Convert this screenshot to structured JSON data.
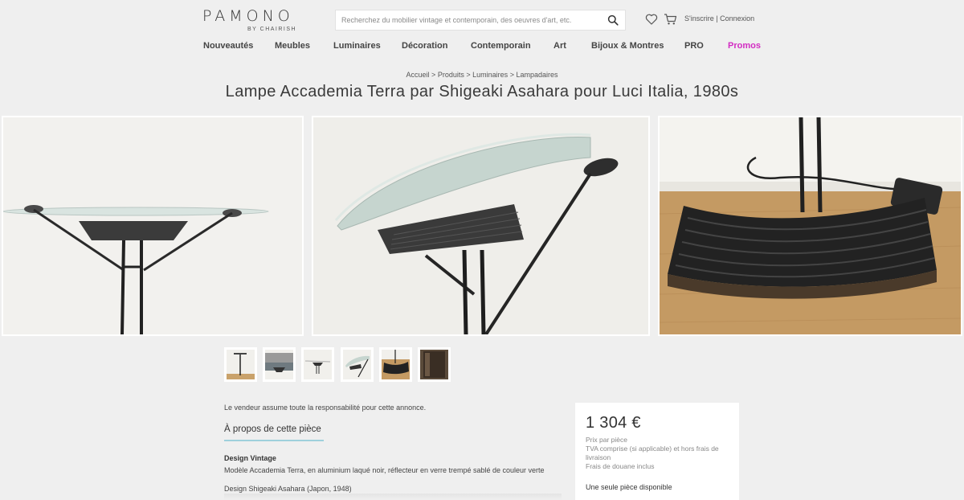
{
  "header": {
    "logo_text": "PAMONO",
    "logo_sub": "BY CHAIRISH",
    "search_placeholder": "Recherchez du mobilier vintage et contemporain, des oeuvres d'art, etc.",
    "signup_label": "S'inscrire",
    "separator": "|",
    "login_label": "Connexion"
  },
  "nav": {
    "items": [
      "Nouveautés",
      "Meubles",
      "Luminaires",
      "Décoration",
      "Contemporain",
      "Art",
      "Bijoux & Montres",
      "PRO",
      "Promos"
    ]
  },
  "breadcrumb": {
    "items": [
      "Accueil",
      "Produits",
      "Luminaires",
      "Lampadaires"
    ],
    "separator": ">"
  },
  "product": {
    "title": "Lampe Accademia Terra par Shigeaki Asahara pour Luci Italia, 1980s",
    "seller_note": "Le vendeur assume toute la responsabilité pour cette annonce.",
    "about_heading": "À propos de cette pièce",
    "design_heading": "Design Vintage",
    "description_1": "Modèle Accademia Terra, en aluminium laqué noir, réflecteur en verre trempé sablé de couleur verte",
    "description_2": "Design Shigeaki Asahara (Japon, 1948)"
  },
  "price": {
    "amount": "1 304 €",
    "note_1": "Prix par pièce",
    "note_2": "TVA comprise (si applicable) et hors frais de livraison",
    "note_3": "Frais de douane inclus",
    "availability": "Une seule pièce disponible"
  },
  "colors": {
    "promo": "#d22cc2",
    "accent_line": "#9ed0dc",
    "background": "#efefef"
  }
}
